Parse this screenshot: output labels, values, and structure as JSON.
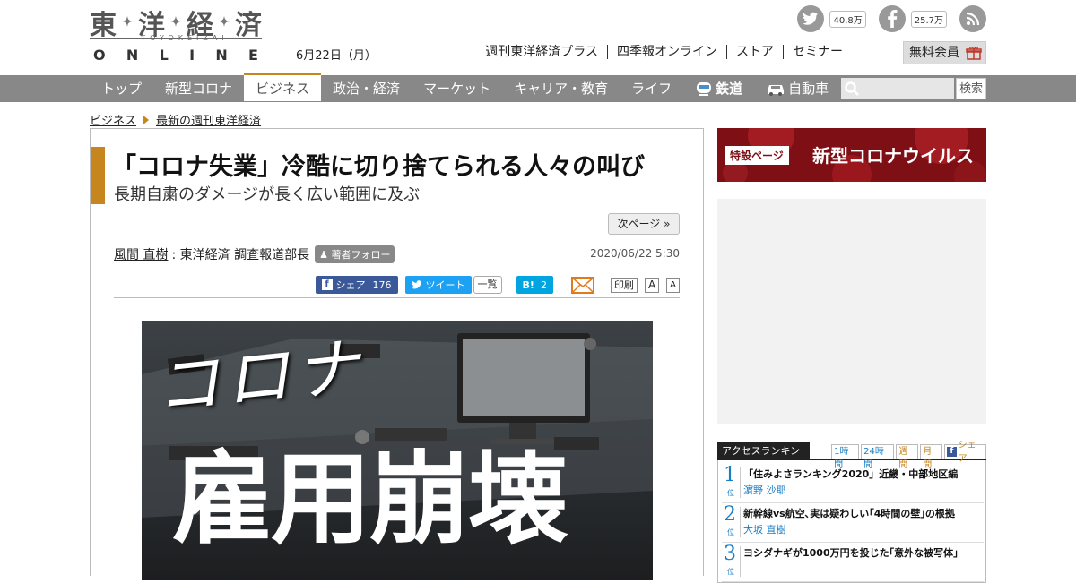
{
  "header": {
    "logo_kanji": [
      "東",
      "洋",
      "経",
      "済"
    ],
    "logo_roman": "TOYOKEIZAI",
    "logo_online": [
      "O",
      "N",
      "L",
      "I",
      "N",
      "E"
    ],
    "date": "6月22日（月）",
    "topnav": [
      "週刊東洋経済プラス",
      "四季報オンライン",
      "ストア",
      "セミナー"
    ],
    "member_button": "無料会員",
    "social": [
      {
        "icon": "twitter-icon",
        "glyph": "t",
        "count": "40.8万"
      },
      {
        "icon": "facebook-icon",
        "glyph": "f",
        "count": "25.7万"
      },
      {
        "icon": "rss-icon",
        "glyph": "))",
        "count": ""
      }
    ]
  },
  "mainnav": {
    "items": [
      "トップ",
      "新型コロナ",
      "ビジネス",
      "政治・経済",
      "マーケット",
      "キャリア・教育",
      "ライフ",
      "鉄道",
      "自動車"
    ],
    "active_index": 2,
    "search_button": "検索"
  },
  "breadcrumb": [
    "ビジネス",
    "最新の週刊東洋経済"
  ],
  "article": {
    "title": "「コロナ失業」冷酷に切り捨てられる人々の叫び",
    "subtitle": "長期自粛のダメージが長く広い範囲に及ぶ",
    "next_page": "次ページ »",
    "author": "風間 直樹",
    "author_role": ": 東洋経済 調査報道部長",
    "follow": "著者フォロー",
    "date": "2020/06/22 5:30",
    "share": {
      "facebook_label": "シェア",
      "facebook_count": "176",
      "tweet_label": "ツイート",
      "tweet_count": "一覧",
      "hatena_label": "B!",
      "hatena_count": "2",
      "print": "印刷",
      "font_large": "A",
      "font_small": "A"
    },
    "hero": {
      "text_top": "コロナ",
      "text_main": "雇用崩壊"
    }
  },
  "sidebar": {
    "banner_tag": "特設ページ",
    "banner_text": "新型コロナウイルス",
    "ranking": {
      "title": "アクセスランキング",
      "tabs": [
        "1時間",
        "24時間",
        "週間",
        "月間",
        "シェア"
      ],
      "items": [
        {
          "rank": "1",
          "suffix": "位",
          "headline": "「住みよさランキング2020」近畿・中部地区編",
          "author": "濵野 沙耶"
        },
        {
          "rank": "2",
          "suffix": "位",
          "headline": "新幹線vs航空､実は疑わしい｢4時間の壁｣の根拠",
          "author": "大坂 直樹"
        },
        {
          "rank": "3",
          "suffix": "位",
          "headline": "ヨシダナギが1000万円を投じた｢意外な被写体｣",
          "author": ""
        }
      ]
    }
  },
  "colors": {
    "accent": "#c7851e",
    "nav_bg": "#888888",
    "link_blue": "#1a7ec4",
    "banner_red": "#7e0f14"
  }
}
